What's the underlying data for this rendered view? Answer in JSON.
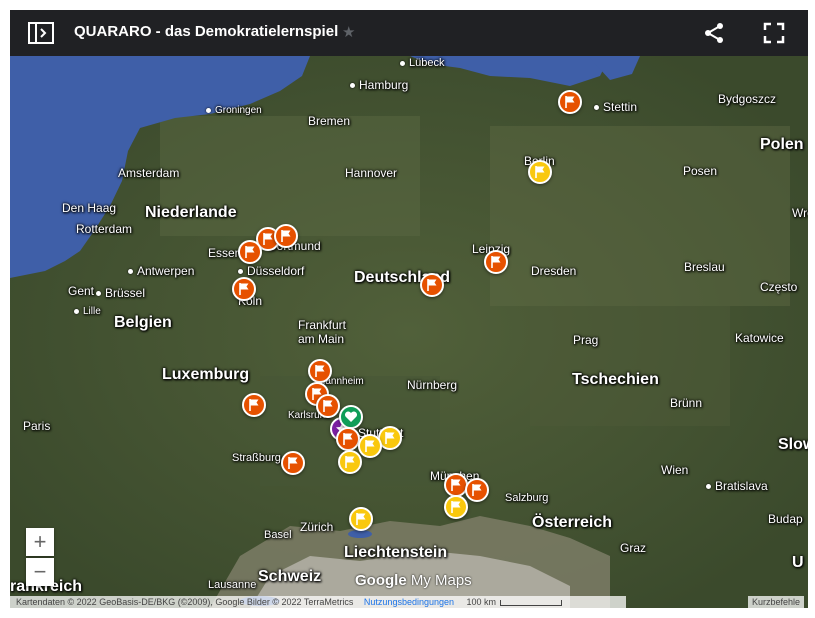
{
  "header": {
    "title": "QUARARO - das Demokratielernspiel",
    "star_icon": "star-icon",
    "share_icon": "share-icon",
    "fullscreen_icon": "fullscreen-icon",
    "legend_icon": "legend-toggle-icon"
  },
  "map": {
    "water_color": "#3f5fa8",
    "land_color": "#40502f",
    "alps_color": "#a9a79a",
    "labels": {
      "luebeck": "Lübeck",
      "hamburg": "Hamburg",
      "stettin": "Stettin",
      "bydgoszcz": "Bydgoszcz",
      "groningen": "Groningen",
      "bremen": "Bremen",
      "polen": "Polen",
      "berlin": "Berlin",
      "amsterdam": "Amsterdam",
      "hannover": "Hannover",
      "posen": "Posen",
      "den_haag": "Den Haag",
      "niederlande": "Niederlande",
      "rotterdam": "Rotterdam",
      "wroclaw": "Wrocław",
      "essen": "Essen",
      "dortmund": "Dortmund",
      "leipzig": "Leipzig",
      "antwerpen": "Antwerpen",
      "duesseldorf": "Düsseldorf",
      "deutschland": "Deutschland",
      "dresden": "Dresden",
      "breslau": "Breslau",
      "gent": "Gent",
      "bruessel": "Brüssel",
      "koeln": "Köln",
      "czestochowa": "Często",
      "lille": "Lille",
      "belgien": "Belgien",
      "frankfurt": "Frankfurt",
      "am_main": "am Main",
      "prag": "Prag",
      "katowice": "Katowice",
      "luxemburg": "Luxemburg",
      "mannheim": "Mannheim",
      "nuernberg": "Nürnberg",
      "tschechien": "Tschechien",
      "paris": "Paris",
      "karlsruhe": "Karlsruhe",
      "stuttgart": "Stuttgart",
      "bruenn": "Brünn",
      "slowakei": "Slow",
      "strassburg": "Straßburg",
      "muenchen": "München",
      "wien": "Wien",
      "bratislava": "Bratislava",
      "salzburg": "Salzburg",
      "zuerich": "Zürich",
      "oesterreich": "Österreich",
      "budapest": "Budap",
      "basel": "Basel",
      "liechtenstein": "Liechtenstein",
      "graz": "Graz",
      "frankreich": "rankreich",
      "schweiz": "Schweiz",
      "lausanne": "Lausanne",
      "ungarn": "U"
    }
  },
  "markers": {
    "orange_color": "#e65100",
    "yellow_color": "#f9c80e",
    "green_color": "#0f9d58",
    "purple_color": "#7b1fa2",
    "flag_icon": "flag-icon",
    "heart_icon": "heart-icon",
    "star_marker_icon": "star-marker-icon"
  },
  "controls": {
    "zoom_in": "+",
    "zoom_out": "−"
  },
  "footer": {
    "attribution": "Kartendaten © 2022 GeoBasis-DE/BKG (©2009), Google Bilder © 2022 TerraMetrics",
    "terms": "Nutzungsbedingungen",
    "scale": "100 km",
    "shortcuts": "Kurzbefehle",
    "logo_google": "Google",
    "logo_mymaps": " My Maps"
  }
}
